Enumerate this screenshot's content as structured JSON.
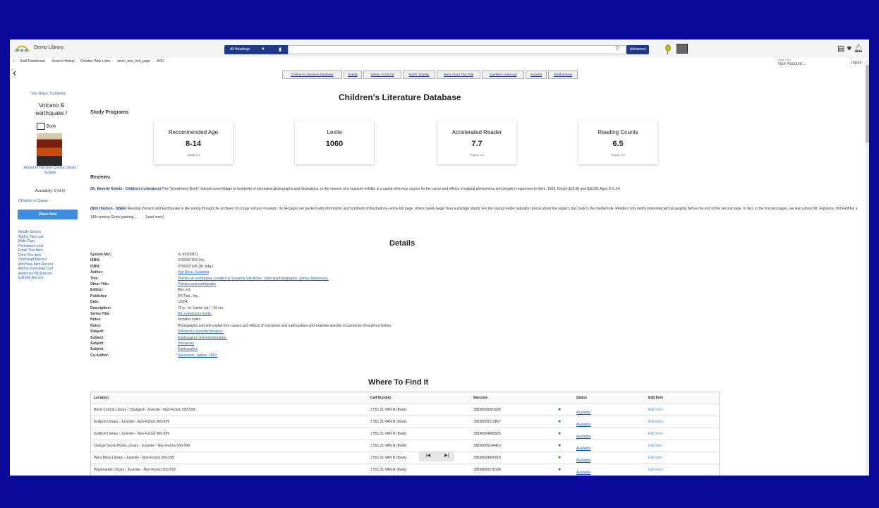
{
  "header": {
    "library_name": "Demo Library",
    "search_type": "All Headings",
    "advanced_label": "Advanced",
    "nav_links": [
      "Staff Dashboard",
      "Search History",
      "October Web Links",
      "anish_test_link_page",
      "ADU"
    ],
    "account_hello": "Hello, PAO",
    "account_label": "Your Account",
    "logout_label": "Logout"
  },
  "tabs": [
    "Children's Literature Database",
    "Details",
    "Where To Find It",
    "MARC Display",
    "More About This Title",
    "Syndetics Unbound",
    "Novelist",
    "Shelf Browse"
  ],
  "sidebar": {
    "author": "Van Rose, Susanna",
    "title": "Volcano & earthquake /",
    "format": "Book",
    "found_in": "Found In Harrison County Library System",
    "availability": "Availability: 6 (of 6)",
    "holds": "0 Hold(s) in Queue",
    "place_hold": "Place Hold",
    "links": [
      "Modify Search",
      "Add to Your List",
      "Multi Copy",
      "Permanent Link",
      "Email This Item",
      "Print This Item",
      "Download Record",
      "Add New Item Record",
      "Add to Download Cart",
      "Authorize Bib Record",
      "Edit Bib Record"
    ]
  },
  "main": {
    "title": "Children's Literature Database",
    "study_programs_label": "Study Programs",
    "cards": [
      {
        "title": "Recommended Age",
        "value": "8-14",
        "sub": "Grade 3-9"
      },
      {
        "title": "Lexile",
        "value": "1060",
        "sub": ""
      },
      {
        "title": "Accelerated Reader",
        "value": "7.7",
        "sub": "Points: 1.0"
      },
      {
        "title": "Reading Counts",
        "value": "6.5",
        "sub": "Points: 5.0"
      }
    ],
    "reviews_label": "Reviews",
    "reviews": [
      {
        "source": "(Dr. Beverly Kobrin - Children's Literature)",
        "text": " This \"Eyewitness Book\" indexed assemblage of hundreds of annotated photographs and illustrations, in the manner of a museum exhibit, is a useful reference source for the cause and effects of natural phenomena and people's responses to them. 1992, Knopf, $19.00 and $20.99. Ages 8 to 14."
      },
      {
        "source": "(Bob Hirshon - SB&F)",
        "text": " Reading Volcano and Earthquake is like poring through the archives of a huge volcano museum. Its 64 pages are packed with information and hundreds of illustrations--some full page, others barely larger than a postage stamp. For the young reader naturally curious about the subject, this book is the motherlode. Readers only mildly interested will be gasping before the end of the second page. In fact, in the first two pages, we learn about Mt. Fujiyama, Old Faithful, a 14th-century Giotto painting ...",
        "more": "(read more)"
      }
    ],
    "details_title": "Details",
    "details": [
      {
        "label": "System Nbr.:",
        "value": "hc 99200871",
        "link": false
      },
      {
        "label": "ISBN:",
        "value": "0756607353 (hc)",
        "link": false
      },
      {
        "label": "ISBN:",
        "value": "0756607345 (lib. bdg.)",
        "link": false
      },
      {
        "label": "Author:",
        "value": "Van Rose, Susanna",
        "link": true
      },
      {
        "label": "Title:",
        "value": "Volcano & earthquake / written by Susanna Van Rose ; [special photography, James Stevenson].",
        "link": true
      },
      {
        "label": "Other Title:",
        "value": "Volcano and earthquake",
        "link": true
      },
      {
        "label": "Edition:",
        "value": "Rev. ed.",
        "link": false
      },
      {
        "label": "Publisher:",
        "value": "DK Pub., Inc.,",
        "link": false
      },
      {
        "label": "Date:",
        "value": "c2004.",
        "link": false
      },
      {
        "label": "Description:",
        "value": "72 p. : ill. (some col.) ; 29 cm.",
        "link": false
      },
      {
        "label": "Series Title:",
        "value": "DK eyewitness books",
        "link": true
      },
      {
        "label": "Notes:",
        "value": "Includes index.",
        "link": false
      },
      {
        "label": "Notes:",
        "value": "Photographs and text explain the causes and effects of volcanoes and earthquakes and examine specific occurrences throughout history.",
        "link": false
      },
      {
        "label": "Subject:",
        "value": "Volcanoes Juvenile literature.",
        "link": true
      },
      {
        "label": "Subject:",
        "value": "Earthquakes Juvenile literature.",
        "link": true
      },
      {
        "label": "Subject:",
        "value": "Volcanoes",
        "link": true
      },
      {
        "label": "Subject:",
        "value": "Earthquakes",
        "link": true
      },
      {
        "label": "Co-Author:",
        "value": "Stevenson, James, 1952-",
        "link": true
      }
    ],
    "where_title": "Where To Find It",
    "table_headers": [
      "Location",
      "Call Number",
      "Barcode",
      "Status",
      "Edit Item"
    ],
    "rows": [
      {
        "location": "Biloxi Central Library - Changed - Juvenile - Non-Fiction 500-599",
        "call": "J 551.21 VAN R (Book)",
        "barcode": "33838005301605",
        "status": "Available",
        "edit": "Edit Item"
      },
      {
        "location": "Gulfport Library - Juvenile - Non-Fiction 500-599",
        "call": "J 551.21 VAN R (Book)",
        "barcode": "33838005313857",
        "status": "Available",
        "edit": "Edit Item"
      },
      {
        "location": "Gulfport Library - Juvenile - Non-Fiction 500-599",
        "call": "J 551.21 VAN R (Book)",
        "barcode": "33838004889925",
        "status": "Available",
        "edit": "Edit Item"
      },
      {
        "location": "Orange Grove Public Library - Juvenile - Non-Fiction 500-599",
        "call": "J 551.21 VAN R (Book)",
        "barcode": "33838005184415",
        "status": "Available",
        "edit": "Edit Item"
      },
      {
        "location": "West Biloxi Library - Juvenile - Non-Fiction 500-599",
        "call": "J 551.21 VAN R (Book)",
        "barcode": "33838004840918",
        "status": "Available",
        "edit": "Edit Item"
      },
      {
        "location": "Woolmarket Library - Juvenile - Non-Fiction 500-599",
        "call": "J 551.21 VAN R (Book)",
        "barcode": "33838005378108",
        "status": "Available",
        "edit": "Edit Item"
      }
    ]
  },
  "colors": {
    "frame": "#0a0a9a",
    "accent": "#1f3a8a",
    "link": "#1f5fbf",
    "available": "#1a8a1a"
  },
  "icons": [
    "home-icon",
    "search-icon",
    "barcode-icon",
    "balloon-icon",
    "image-icon",
    "card-icon",
    "heart-icon",
    "bell-icon",
    "back-arrow-icon",
    "book-icon",
    "first-page-icon",
    "last-page-icon"
  ]
}
